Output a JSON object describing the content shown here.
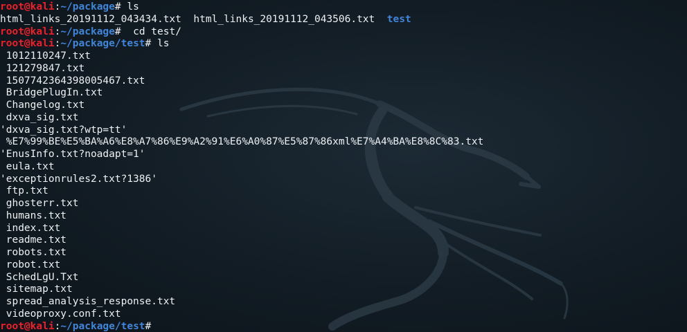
{
  "terminal": {
    "lines": [
      {
        "type": "prompt",
        "user": "root@kali",
        "path": "~/package",
        "symbol": "#",
        "command": " ls"
      },
      {
        "type": "ls",
        "items": [
          {
            "text": "html_links_20191112_043434.txt",
            "dir": false
          },
          {
            "text": "html_links_20191112_043506.txt",
            "dir": false
          },
          {
            "text": "test",
            "dir": true
          }
        ]
      },
      {
        "type": "prompt",
        "user": "root@kali",
        "path": "~/package",
        "symbol": "#",
        "command": "  cd test/"
      },
      {
        "type": "prompt",
        "user": "root@kali",
        "path": "~/package/test",
        "symbol": "#",
        "command": " ls"
      },
      {
        "type": "output",
        "text": " 1012110247.txt"
      },
      {
        "type": "output",
        "text": " 121279847.txt"
      },
      {
        "type": "output",
        "text": " 1507742364398005467.txt"
      },
      {
        "type": "output",
        "text": " BridgePlugIn.txt"
      },
      {
        "type": "output",
        "text": " Changelog.txt"
      },
      {
        "type": "output",
        "text": " dxva_sig.txt"
      },
      {
        "type": "output",
        "text": "'dxva_sig.txt?wtp=tt'"
      },
      {
        "type": "output",
        "text": " %E7%99%BE%E5%BA%A6%E8%A7%86%E9%A2%91%E6%A0%87%E5%87%86xml%E7%A4%BA%E8%8C%83.txt"
      },
      {
        "type": "output",
        "text": "'EnusInfo.txt?noadapt=1'"
      },
      {
        "type": "output",
        "text": " eula.txt"
      },
      {
        "type": "output",
        "text": "'exceptionrules2.txt?1386'"
      },
      {
        "type": "output",
        "text": " ftp.txt"
      },
      {
        "type": "output",
        "text": " ghosterr.txt"
      },
      {
        "type": "output",
        "text": " humans.txt"
      },
      {
        "type": "output",
        "text": " index.txt"
      },
      {
        "type": "output",
        "text": " readme.txt"
      },
      {
        "type": "output",
        "text": " robots.txt"
      },
      {
        "type": "output",
        "text": " robot.txt"
      },
      {
        "type": "output",
        "text": " SchedLgU.Txt"
      },
      {
        "type": "output",
        "text": " sitemap.txt"
      },
      {
        "type": "output",
        "text": " spread_analysis_response.txt"
      },
      {
        "type": "output",
        "text": " videoproxy.conf.txt"
      },
      {
        "type": "prompt",
        "user": "root@kali",
        "path": "~/package/test",
        "symbol": "#",
        "command": ""
      }
    ]
  },
  "colors": {
    "background": "#121c24",
    "text": "#eef1f3",
    "user": "#ee1f2a",
    "path": "#3f86d8",
    "directory": "#3f86d8"
  },
  "background_logo": "kali-dragon-icon"
}
